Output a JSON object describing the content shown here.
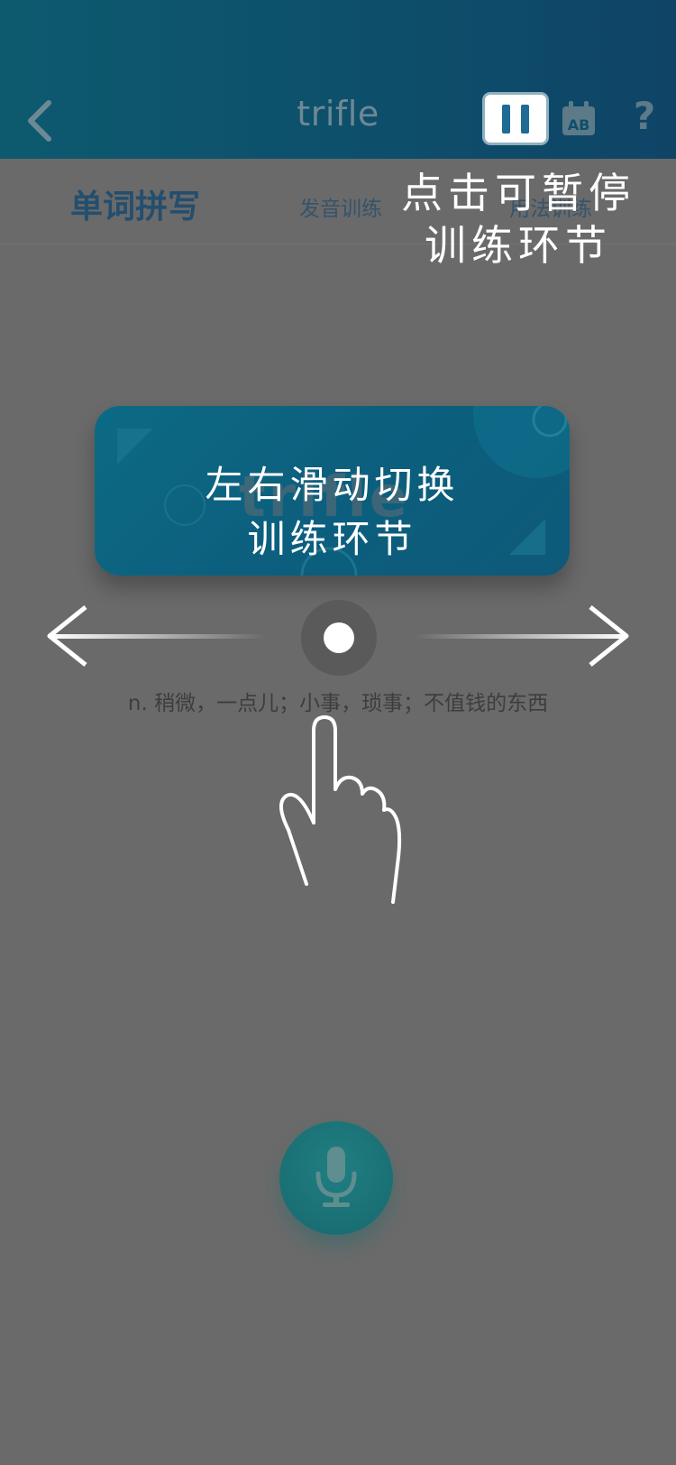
{
  "header": {
    "title": "trifle",
    "back_icon": "chevron-left-icon",
    "pause_icon": "pause-icon",
    "ab_icon": "calendar-ab-icon",
    "help_icon": "?"
  },
  "tabs": {
    "active": "单词拼写",
    "second": "发音训练",
    "third": "用法训练"
  },
  "overlay": {
    "pause_hint": "点击可暂停训练环节",
    "swipe_hint_line1": "左右滑动切换",
    "swipe_hint_line2": "训练环节"
  },
  "card": {
    "word": "trifle"
  },
  "definition": "n. 稍微，一点儿；小事，琐事；不值钱的东西",
  "mic": {
    "icon": "microphone-icon"
  },
  "colors": {
    "header_start": "#0d5a6e",
    "header_end": "#0f4467",
    "overlay_bg": "#6a6a6a",
    "card_bg": "#0c6a84",
    "mic_bg": "#1a6f74"
  }
}
